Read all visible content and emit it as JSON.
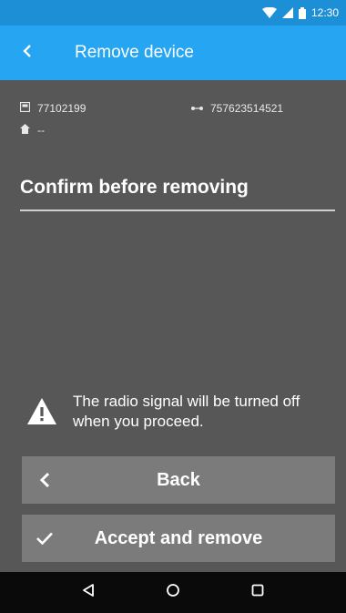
{
  "status_bar": {
    "time": "12:30"
  },
  "app_bar": {
    "title": "Remove device"
  },
  "device": {
    "serial": "77102199",
    "sim_number": "757623514521",
    "home": "--"
  },
  "confirm": {
    "title": "Confirm before removing",
    "warning": "The radio signal will be turned off when you proceed."
  },
  "actions": {
    "back_label": "Back",
    "accept_label": "Accept and remove"
  },
  "colors": {
    "status_bar": "#1d8fd6",
    "app_bar": "#25a5f2",
    "background": "#575757",
    "button": "#7b7b7b",
    "nav_bar": "#0a0a0a"
  },
  "icons": {
    "app_bar_back": "chevron-left-icon",
    "serial": "device-icon",
    "sim": "signal-link-icon",
    "home": "home-icon",
    "warning": "warning-triangle-icon",
    "back_button": "chevron-left-icon",
    "accept_button": "checkmark-icon",
    "nav": [
      "nav-back-icon",
      "nav-home-icon",
      "nav-recents-icon"
    ]
  }
}
